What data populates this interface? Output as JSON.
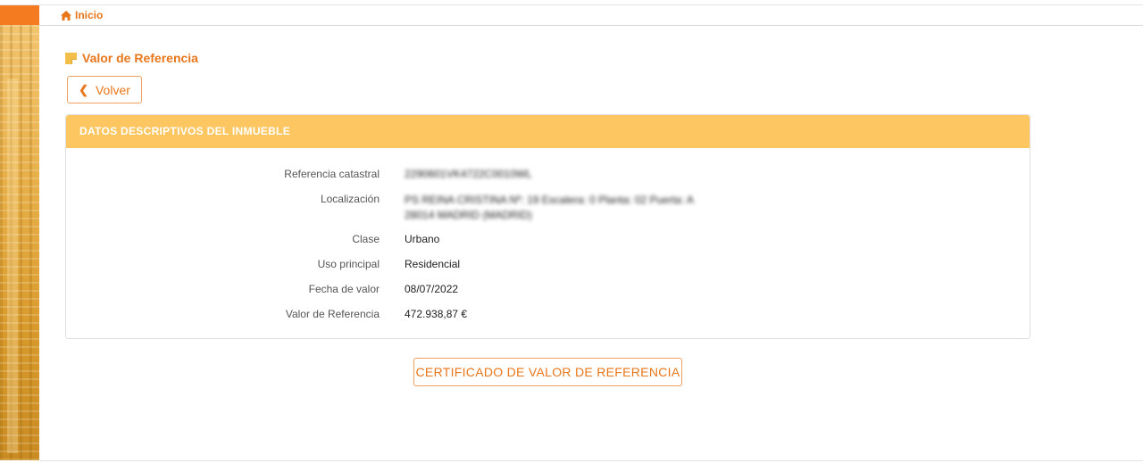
{
  "breadcrumb": {
    "home_label": "Inicio"
  },
  "page": {
    "title": "Valor de Referencia"
  },
  "actions": {
    "back_label": "Volver",
    "certificate_label": "CERTIFICADO DE VALOR DE REFERENCIA"
  },
  "panel": {
    "header": "DATOS DESCRIPTIVOS DEL INMUEBLE",
    "fields": [
      {
        "label": "Referencia catastral",
        "value": "2290601VK4722C0010WL"
      },
      {
        "label": "Localización",
        "value_line1": "PS REINA CRISTINA Nº: 19 Escalera: 0 Planta: 02 Puerta: A",
        "value_line2": "28014 MADRID (MADRID)"
      },
      {
        "label": "Clase",
        "value": "Urbano"
      },
      {
        "label": "Uso principal",
        "value": "Residencial"
      },
      {
        "label": "Fecha de valor",
        "value": "08/07/2022"
      },
      {
        "label": "Valor de Referencia",
        "value": "472.938,87 €"
      }
    ]
  },
  "colors": {
    "accent": "#e8761a",
    "panel_header": "#fdc660",
    "sidebar": "#f47b20"
  },
  "icons": {
    "breadcrumb": "home-icon",
    "title": "note-icon",
    "back": "chevron-left-icon"
  }
}
